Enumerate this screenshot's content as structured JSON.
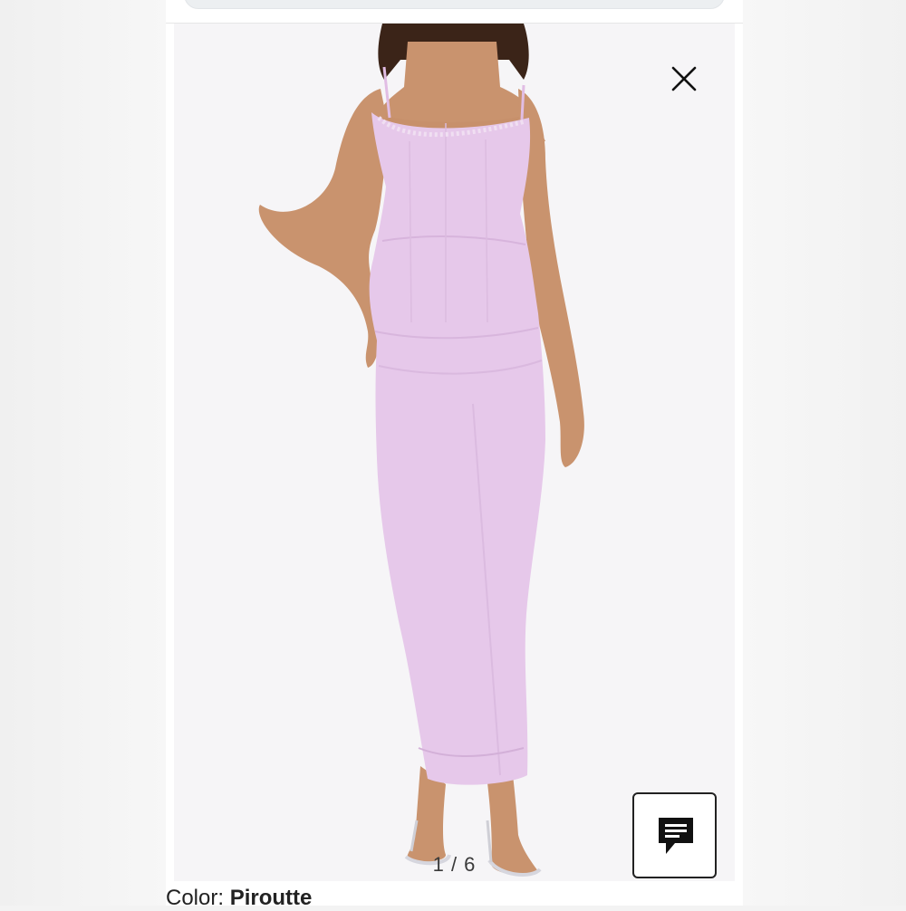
{
  "gallery": {
    "counter": "1 / 6",
    "close_icon": "close-icon",
    "chat_icon": "chat-message-icon"
  },
  "product": {
    "color_label": "Color:",
    "color_value": "Piroutte"
  },
  "colors": {
    "dress": "#e6c8ea",
    "background": "#f6f5f7",
    "skin": "#c9936e",
    "hair": "#3b2418"
  }
}
